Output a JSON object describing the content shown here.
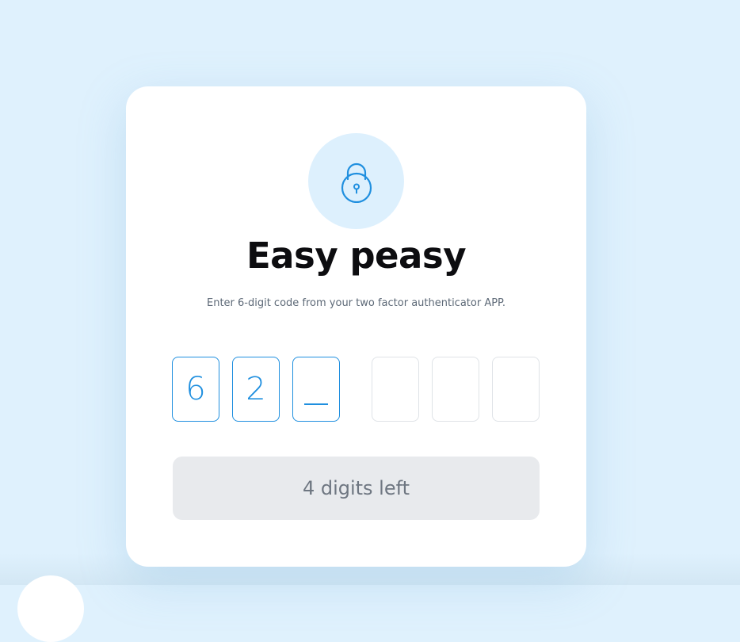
{
  "title": "Easy peasy",
  "subtitle": "Enter 6-digit code from your two factor authenticator APP.",
  "code": {
    "digits": [
      "6",
      "2",
      "",
      "",
      "",
      ""
    ],
    "length": 6,
    "filled": 2
  },
  "status_label": "4 digits left",
  "colors": {
    "background": "#dff1fd",
    "accent": "#1f8fdf",
    "icon_circle": "#ddf0fd",
    "status_bg": "#e8eaed"
  },
  "icons": {
    "lock": "lock-icon"
  }
}
